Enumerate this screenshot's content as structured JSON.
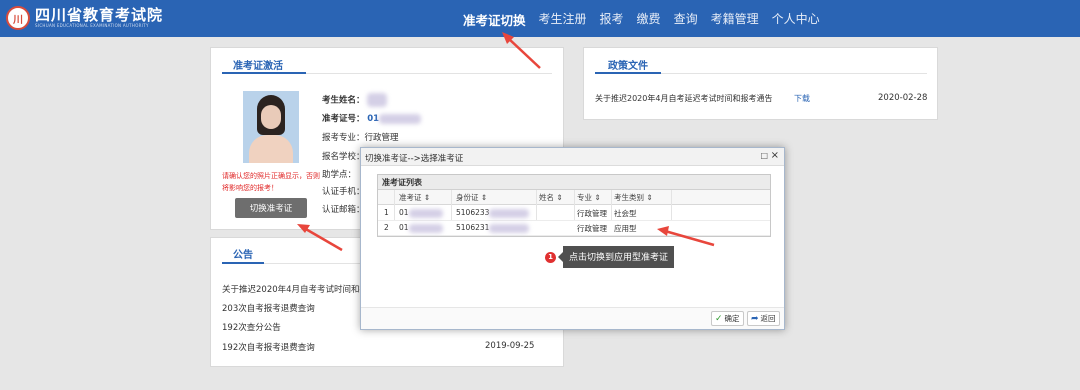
{
  "header": {
    "logo_mark": "川",
    "logo_cn": "四川省教育考试院",
    "logo_en": "SICHUAN EDUCATIONAL EXAMINATION AUTHORITY",
    "nav": [
      "准考证切换",
      "考生注册",
      "报考",
      "缴费",
      "查询",
      "考籍管理",
      "个人中心"
    ]
  },
  "card": {
    "title": "准考证激活",
    "name_label": "考生姓名：",
    "ticket_label": "准考证号：",
    "ticket_prefix": "01",
    "major_label": "报考专业：",
    "major_value": "行政管理",
    "school_label": "报名学校：",
    "helper_label": "助学点：",
    "phone_label": "认证手机：",
    "email_label": "认证邮箱：",
    "photo_note": "请确认您的照片正确显示，否则将影响您的报考！",
    "switch_button": "切换准考证"
  },
  "notice": {
    "title": "公告",
    "items": [
      {
        "text": "关于推迟2020年4月自考考试时间和报",
        "date": ""
      },
      {
        "text": "203次自考报考退费查询",
        "date": ""
      },
      {
        "text": "192次查分公告",
        "date": ""
      },
      {
        "text": "192次自考报考退费查询",
        "date": "2019-09-25"
      }
    ]
  },
  "policy": {
    "title": "政策文件",
    "items": [
      {
        "text": "关于推迟2020年4月自考延迟考试时间和报考通告",
        "link": "下载",
        "date": "2020-02-28"
      }
    ]
  },
  "modal": {
    "title": "切换准考证-->选择准考证",
    "grid_caption": "准考证列表",
    "columns": [
      "准考证",
      "身份证",
      "姓名",
      "专业",
      "考生类别"
    ],
    "rows": [
      {
        "index": "1",
        "ticket": "01",
        "id_card": "5106233",
        "name": "",
        "major": "行政管理",
        "category": "社会型"
      },
      {
        "index": "2",
        "ticket": "01",
        "id_card": "5106231",
        "name": "",
        "major": "行政管理",
        "category": "应用型"
      }
    ],
    "confirm_button": "确定",
    "back_button": "返回"
  },
  "tooltip": {
    "badge": "1",
    "text": "点击切换到应用型准考证"
  },
  "colors": {
    "brand_blue": "#2a64b4",
    "arrow_red": "#e8463c",
    "warning_red": "#e02727"
  }
}
